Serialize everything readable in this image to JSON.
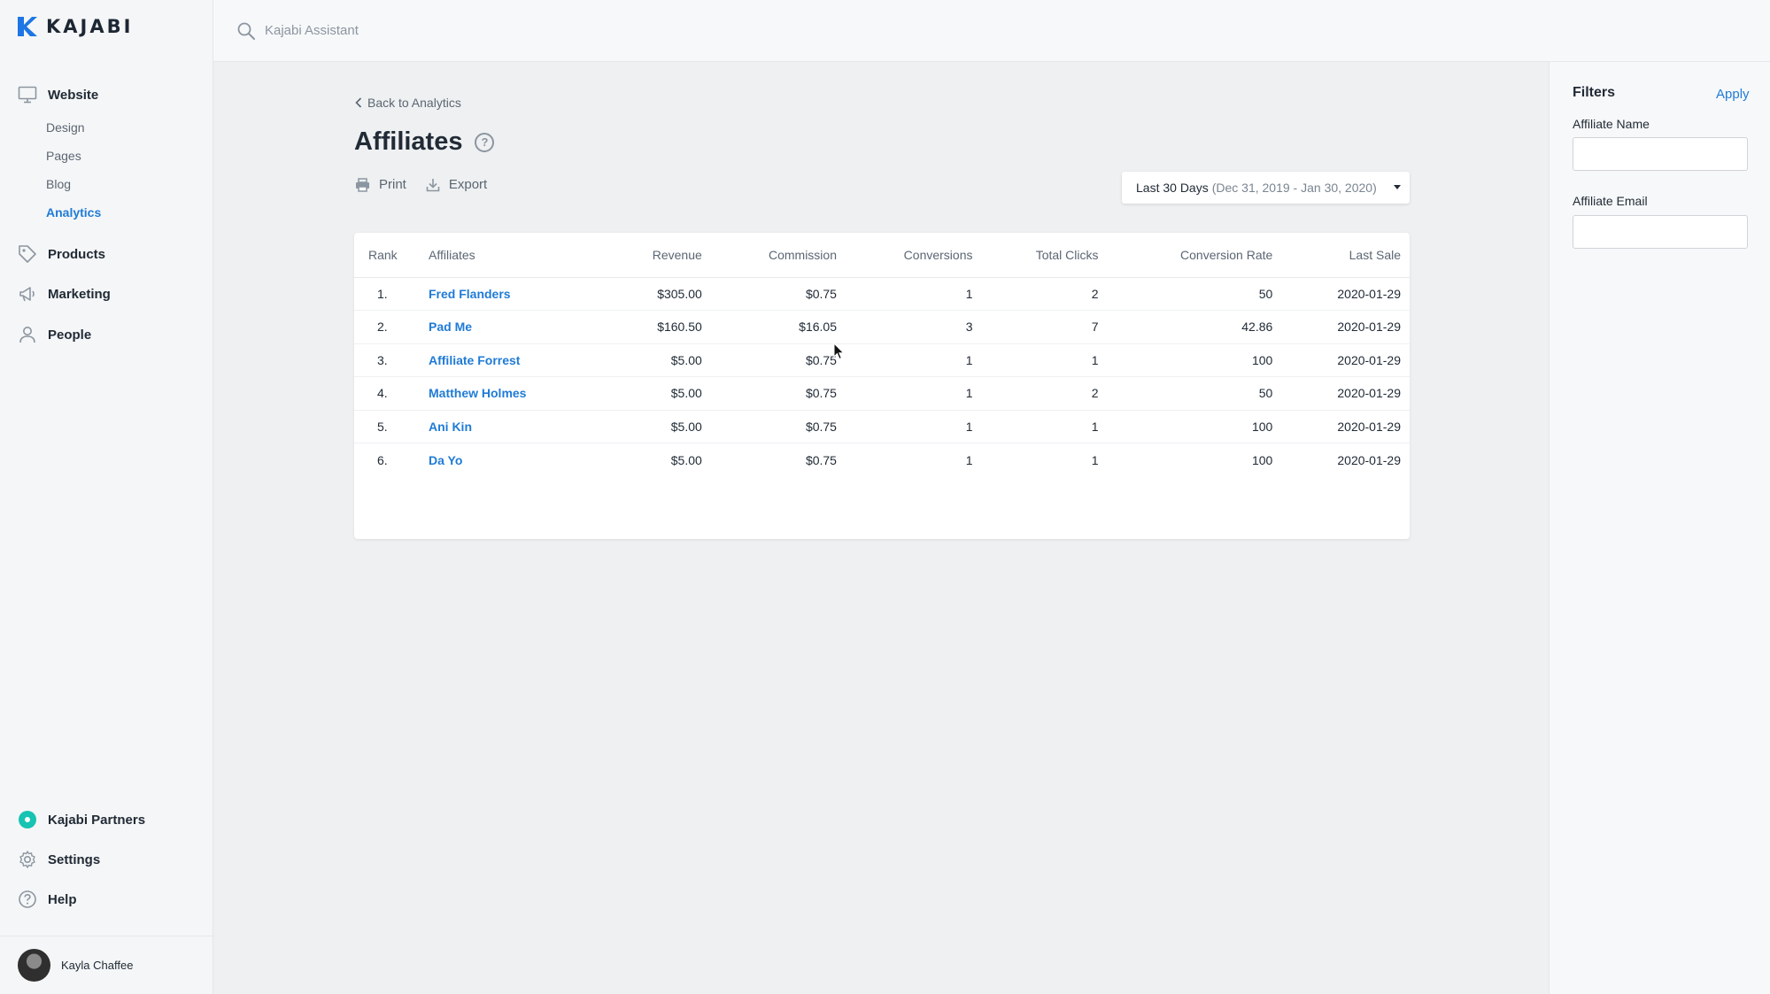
{
  "brand": {
    "name": "KAJABI",
    "accent": "#1f7bd6",
    "logo_color": "#1d76e3"
  },
  "search": {
    "placeholder": "Kajabi Assistant",
    "icon": "search-icon"
  },
  "sidebar": {
    "sections": [
      {
        "label": "Website",
        "icon": "monitor-icon"
      },
      {
        "label": "Products",
        "icon": "tag-icon"
      },
      {
        "label": "Marketing",
        "icon": "megaphone-icon"
      },
      {
        "label": "People",
        "icon": "person-icon"
      }
    ],
    "website_sub": [
      {
        "label": "Design",
        "active": false
      },
      {
        "label": "Pages",
        "active": false
      },
      {
        "label": "Blog",
        "active": false
      },
      {
        "label": "Analytics",
        "active": true
      }
    ],
    "bottom": [
      {
        "label": "Kajabi Partners",
        "icon": "partners-dot-icon"
      },
      {
        "label": "Settings",
        "icon": "gear-icon"
      },
      {
        "label": "Help",
        "icon": "help-icon"
      }
    ],
    "user": {
      "name": "Kayla Chaffee"
    }
  },
  "main": {
    "back_label": "Back to Analytics",
    "title": "Affiliates",
    "actions": {
      "print": "Print",
      "export": "Export"
    },
    "date_filter": {
      "label": "Last 30 Days",
      "range": "(Dec 31, 2019 - Jan 30, 2020)"
    },
    "table": {
      "columns": [
        "Rank",
        "Affiliates",
        "Revenue",
        "Commission",
        "Conversions",
        "Total Clicks",
        "Conversion Rate",
        "Last Sale"
      ],
      "rows": [
        {
          "rank": "1.",
          "name": "Fred Flanders",
          "revenue": "$305.00",
          "commission": "$0.75",
          "conversions": "1",
          "clicks": "2",
          "rate": "50",
          "last_sale": "2020-01-29"
        },
        {
          "rank": "2.",
          "name": "Pad Me",
          "revenue": "$160.50",
          "commission": "$16.05",
          "conversions": "3",
          "clicks": "7",
          "rate": "42.86",
          "last_sale": "2020-01-29"
        },
        {
          "rank": "3.",
          "name": "Affiliate Forrest",
          "revenue": "$5.00",
          "commission": "$0.75",
          "conversions": "1",
          "clicks": "1",
          "rate": "100",
          "last_sale": "2020-01-29"
        },
        {
          "rank": "4.",
          "name": "Matthew Holmes",
          "revenue": "$5.00",
          "commission": "$0.75",
          "conversions": "1",
          "clicks": "2",
          "rate": "50",
          "last_sale": "2020-01-29"
        },
        {
          "rank": "5.",
          "name": "Ani Kin",
          "revenue": "$5.00",
          "commission": "$0.75",
          "conversions": "1",
          "clicks": "1",
          "rate": "100",
          "last_sale": "2020-01-29"
        },
        {
          "rank": "6.",
          "name": "Da Yo",
          "revenue": "$5.00",
          "commission": "$0.75",
          "conversions": "1",
          "clicks": "1",
          "rate": "100",
          "last_sale": "2020-01-29"
        }
      ]
    }
  },
  "filters": {
    "title": "Filters",
    "apply": "Apply",
    "affiliate_name_label": "Affiliate Name",
    "affiliate_name_value": "",
    "affiliate_email_label": "Affiliate Email",
    "affiliate_email_value": ""
  }
}
